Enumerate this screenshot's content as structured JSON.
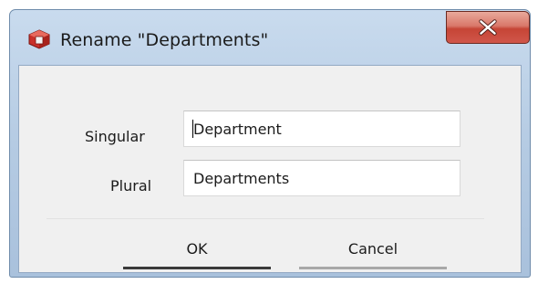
{
  "dialog": {
    "title": "Rename \"Departments\"",
    "app_icon": "red-cube-icon",
    "close_icon": "close-x-icon",
    "accent_close": "#c64536"
  },
  "form": {
    "singular_label": "Singular",
    "singular_value": "Department",
    "plural_label": "Plural",
    "plural_value": "Departments"
  },
  "buttons": {
    "ok_label": "OK",
    "cancel_label": "Cancel"
  }
}
